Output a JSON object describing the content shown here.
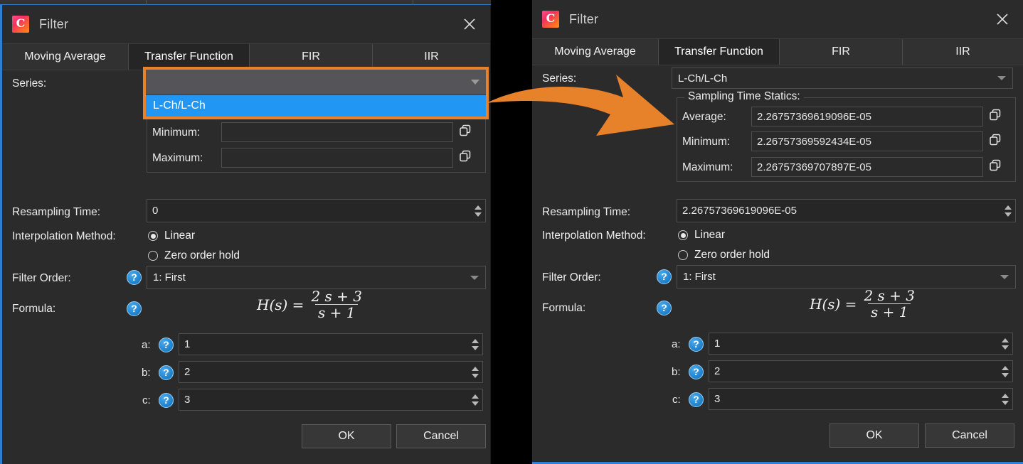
{
  "window": {
    "title": "Filter",
    "app_icon": "app-c-icon",
    "close_icon": "close-icon"
  },
  "tabs": [
    {
      "label": "Moving Average",
      "active": false
    },
    {
      "label": "Transfer Function",
      "active": true
    },
    {
      "label": "FIR",
      "active": false
    },
    {
      "label": "IIR",
      "active": false
    }
  ],
  "labels": {
    "series": "Series:",
    "sampling_group": "Sampling Time Statics:",
    "average": "Average:",
    "minimum": "Minimum:",
    "maximum": "Maximum:",
    "resampling_time": "Resampling Time:",
    "interpolation_method": "Interpolation Method:",
    "filter_order": "Filter Order:",
    "formula": "Formula:",
    "coef_a": "a:",
    "coef_b": "b:",
    "coef_c": "c:"
  },
  "radios": {
    "linear": "Linear",
    "zero_order_hold": "Zero order hold"
  },
  "buttons": {
    "ok": "OK",
    "cancel": "Cancel"
  },
  "formula": {
    "lhs": "H(s) =",
    "numerator": "2 s + 3",
    "denominator": "s + 1"
  },
  "colors": {
    "accent_orange": "#e8822a",
    "highlight_blue": "#2196f3",
    "window_border_blue": "#2b7fd4",
    "dialog_bg": "#2b2b2b",
    "field_bg": "#262626"
  },
  "left_panel": {
    "series_combo_value": "",
    "series_dropdown_open": true,
    "series_dropdown_items": [
      "L-Ch/L-Ch"
    ],
    "average": "",
    "minimum": "",
    "maximum": "",
    "resampling_time": "0",
    "interpolation_selected": "Linear",
    "filter_order": "1: First",
    "coef_a": "1",
    "coef_b": "2",
    "coef_c": "3"
  },
  "right_panel": {
    "series_combo_value": "L-Ch/L-Ch",
    "series_dropdown_open": false,
    "average": "2.26757369619096E-05",
    "minimum": "2.26757369592434E-05",
    "maximum": "2.26757369707897E-05",
    "resampling_time": "2.26757369619096E-05",
    "interpolation_selected": "Linear",
    "filter_order": "1: First",
    "coef_a": "1",
    "coef_b": "2",
    "coef_c": "3"
  },
  "annotation": {
    "arrow_icon": "curved-arrow-right",
    "arrow_color": "#e8822a"
  }
}
